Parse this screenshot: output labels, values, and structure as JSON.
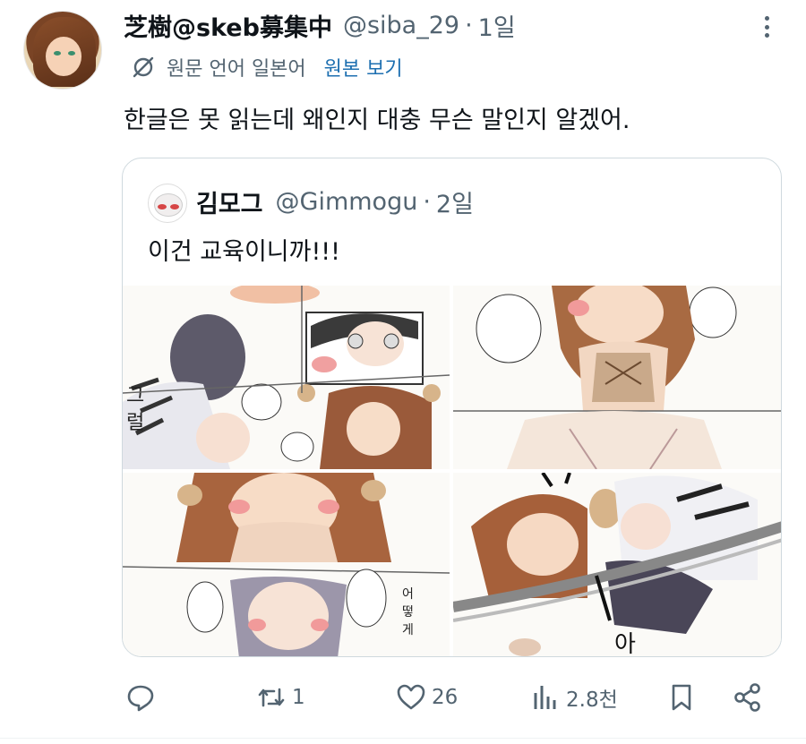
{
  "tweet": {
    "display_name": "芝樹@skeb募集中",
    "handle": "@siba_29",
    "separator": "·",
    "time": "1일",
    "translation": {
      "language_label": "원문 언어 일본어",
      "show_original_label": "원본 보기"
    },
    "text": "한글은 못 읽는데 왜인지 대충 무슨 말인지 알겠어."
  },
  "quoted_tweet": {
    "display_name": "김모그",
    "handle": "@Gimmogu",
    "separator": "·",
    "time": "2일",
    "text": "이건 교육이니까!!!",
    "images": [
      "comic-panel-1",
      "comic-panel-2",
      "comic-panel-3",
      "comic-panel-4"
    ]
  },
  "actions": {
    "reply_count": "",
    "retweet_count": "1",
    "like_count": "26",
    "view_count": "2.8천"
  },
  "icons": {
    "more": "more-vertical-icon",
    "translate": "translate-icon",
    "reply": "reply-icon",
    "retweet": "retweet-icon",
    "like": "heart-icon",
    "views": "views-icon",
    "bookmark": "bookmark-icon",
    "share": "share-icon"
  },
  "colors": {
    "text": "#0f1419",
    "secondary": "#536471",
    "link": "#1d6fb0",
    "border": "#cfd9de"
  }
}
